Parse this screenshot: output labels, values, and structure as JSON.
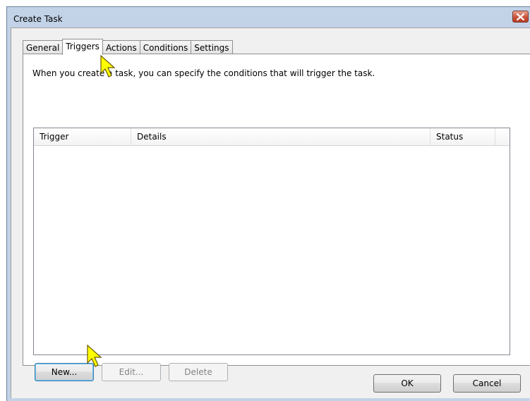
{
  "window": {
    "title": "Create Task"
  },
  "tabs": [
    {
      "label": "General",
      "active": false
    },
    {
      "label": "Triggers",
      "active": true
    },
    {
      "label": "Actions",
      "active": false
    },
    {
      "label": "Conditions",
      "active": false
    },
    {
      "label": "Settings",
      "active": false
    }
  ],
  "triggers_panel": {
    "description": "When you create a task, you can specify the conditions that will trigger the task.",
    "columns": [
      "Trigger",
      "Details",
      "Status"
    ],
    "rows": [],
    "buttons": {
      "new": {
        "label": "New...",
        "enabled": true
      },
      "edit": {
        "label": "Edit...",
        "enabled": false
      },
      "delete": {
        "label": "Delete",
        "enabled": false
      }
    }
  },
  "footer": {
    "ok_label": "OK",
    "cancel_label": "Cancel"
  },
  "icons": {
    "close": "close-icon",
    "cursor": "pointer-cursor-icon"
  },
  "colors": {
    "frame": "#c2d3e8",
    "client": "#f0f0f0",
    "close_button": "#c9553b",
    "cursor_highlight": "#ffff00"
  }
}
